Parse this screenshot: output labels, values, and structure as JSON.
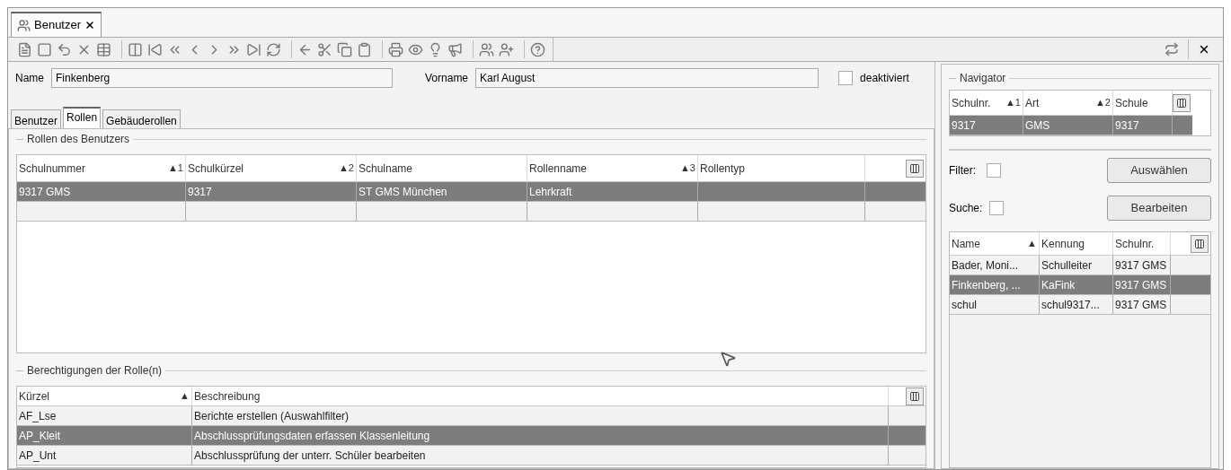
{
  "document_tabs": [
    {
      "label": "Benutzer",
      "selected": true
    }
  ],
  "form": {
    "name_label": "Name",
    "name_value": "Finkenberg",
    "vorname_label": "Vorname",
    "vorname_value": "Karl August",
    "deaktiviert": {
      "label": "deaktiviert",
      "checked": false
    }
  },
  "tabs": [
    {
      "label": "Benutzer",
      "selected": false
    },
    {
      "label": "Rollen",
      "selected": true
    },
    {
      "label": "Gebäuderollen",
      "selected": false
    }
  ],
  "roles": {
    "title": "Rollen des Benutzers",
    "columns": [
      {
        "label": "Schulnummer",
        "sort": "▲1"
      },
      {
        "label": "Schulkürzel",
        "sort": "▲2"
      },
      {
        "label": "Schulname"
      },
      {
        "label": "Rollenname",
        "sort": "▲3"
      },
      {
        "label": "Rollentyp"
      }
    ],
    "rows": [
      {
        "cells": [
          "9317 GMS",
          "9317",
          "ST GMS München",
          "Lehrkraft",
          ""
        ],
        "selected": true
      },
      {
        "cells": [
          "",
          "",
          "",
          "",
          ""
        ],
        "selected": false
      }
    ]
  },
  "permissions": {
    "title": "Berechtigungen der Rolle(n)",
    "columns": [
      {
        "label": "Kürzel",
        "sort": "▲"
      },
      {
        "label": "Beschreibung"
      }
    ],
    "rows": [
      {
        "cells": [
          "AF_Lse",
          "Berichte erstellen (Auswahlfilter)"
        ],
        "selected": false
      },
      {
        "cells": [
          "AP_Kleit",
          "Abschlussprüfungsdaten erfassen Klassenleitung"
        ],
        "selected": true
      },
      {
        "cells": [
          "AP_Unt",
          "Abschlussprüfung der unterr. Schüler bearbeiten"
        ],
        "selected": false
      }
    ]
  },
  "navigator": {
    "title": "Navigator",
    "columns": [
      {
        "label": "Schulnr.",
        "sort": "▲1"
      },
      {
        "label": "Art",
        "sort": "▲2"
      },
      {
        "label": "Schule"
      }
    ],
    "rows": [
      {
        "cells": [
          "9317",
          "GMS",
          "9317"
        ],
        "selected": true
      }
    ],
    "filter": {
      "label": "Filter:",
      "checked": false
    },
    "search": {
      "label": "Suche:",
      "checked": false
    },
    "buttons": [
      "Auswählen",
      "Bearbeiten"
    ],
    "user_columns": [
      {
        "label": "Name",
        "sort": "▲"
      },
      {
        "label": "Kennung"
      },
      {
        "label": "Schulnr."
      }
    ],
    "user_rows": [
      {
        "cells": [
          "Bader, Moni...",
          "Schulleiter",
          "9317 GMS"
        ],
        "selected": false
      },
      {
        "cells": [
          "Finkenberg, ...",
          "KaFink",
          "9317 GMS"
        ],
        "selected": true
      },
      {
        "cells": [
          "schul",
          "schul9317...",
          "9317 GMS"
        ],
        "selected": false
      }
    ]
  }
}
